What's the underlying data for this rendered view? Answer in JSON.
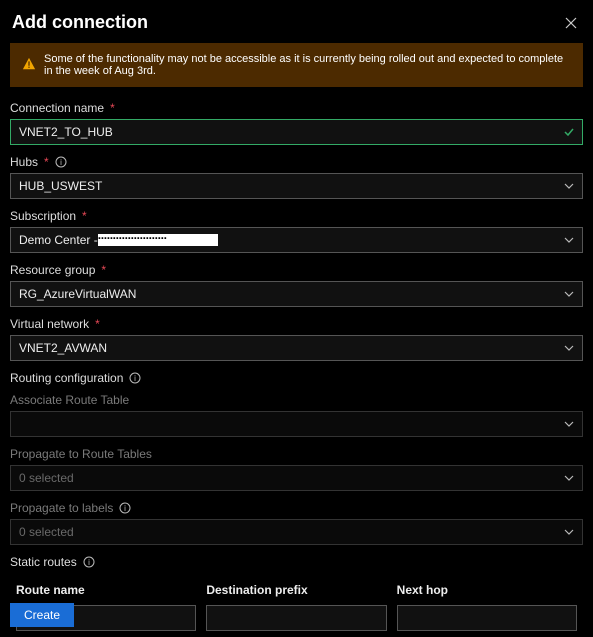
{
  "header": {
    "title": "Add connection"
  },
  "warning": {
    "text": "Some of the functionality may not be accessible as it is currently being rolled out and expected to complete in the week of Aug 3rd."
  },
  "fields": {
    "connection_name": {
      "label": "Connection name",
      "required": true,
      "value": "VNET2_TO_HUB"
    },
    "hubs": {
      "label": "Hubs",
      "required": true,
      "info": true,
      "value": "HUB_USWEST"
    },
    "subscription": {
      "label": "Subscription",
      "required": true,
      "value_prefix": "Demo Center - ",
      "redacted": true
    },
    "resource_group": {
      "label": "Resource group",
      "required": true,
      "value": "RG_AzureVirtualWAN"
    },
    "virtual_network": {
      "label": "Virtual network",
      "required": true,
      "value": "VNET2_AVWAN"
    }
  },
  "routing": {
    "section_label": "Routing configuration",
    "associate": {
      "label": "Associate Route Table",
      "value": ""
    },
    "propagate_tables": {
      "label": "Propagate to Route Tables",
      "value": "0 selected"
    },
    "propagate_labels": {
      "label": "Propagate to labels",
      "info": true,
      "value": "0 selected"
    },
    "static": {
      "section_label": "Static routes",
      "cols": {
        "route_name": "Route name",
        "destination_prefix": "Destination prefix",
        "next_hop": "Next hop"
      }
    }
  },
  "footer": {
    "create": "Create"
  }
}
